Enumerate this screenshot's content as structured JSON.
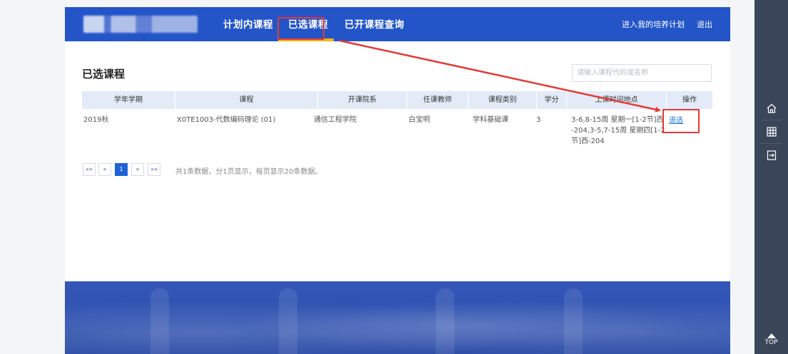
{
  "nav": {
    "items": [
      {
        "label": "计划内课程"
      },
      {
        "label": "已选课程",
        "active": true
      },
      {
        "label": "已开课程查询"
      }
    ],
    "plan_link": "进入我的培养计划",
    "logout": "退出",
    "accent_color": "#2355c8",
    "active_underline_color": "#f5b400"
  },
  "main": {
    "title": "已选课程",
    "search": {
      "placeholder": "请输入课程代码或名称",
      "value": ""
    }
  },
  "table": {
    "headers": [
      "学年学期",
      "课程",
      "开课院系",
      "任课教师",
      "课程类别",
      "学分",
      "上课时间地点",
      "操作"
    ],
    "rows": [
      {
        "term": "2019秋",
        "course": "X0TE1003-代数编码理论 (01)",
        "department": "通信工程学院",
        "teacher": "白宝明",
        "category": "学科基础课",
        "credits": "3",
        "schedule_line1": "3-6,8-15周 星期一[1-2节]西",
        "schedule_line2": "-204,3-5,7-15周 星期四[1-2",
        "schedule_line3": "节]西-204",
        "action": "退选"
      }
    ]
  },
  "pager": {
    "first": "««",
    "prev": "«",
    "current": "1",
    "next": "»",
    "last": "»»",
    "info": "共1条数据，分1页显示，每页显示20条数据。"
  },
  "rail": {
    "icons": [
      "home-icon",
      "grid-icon",
      "logout-icon"
    ],
    "top_label": "TOP"
  },
  "annotation_color": "#e53935"
}
